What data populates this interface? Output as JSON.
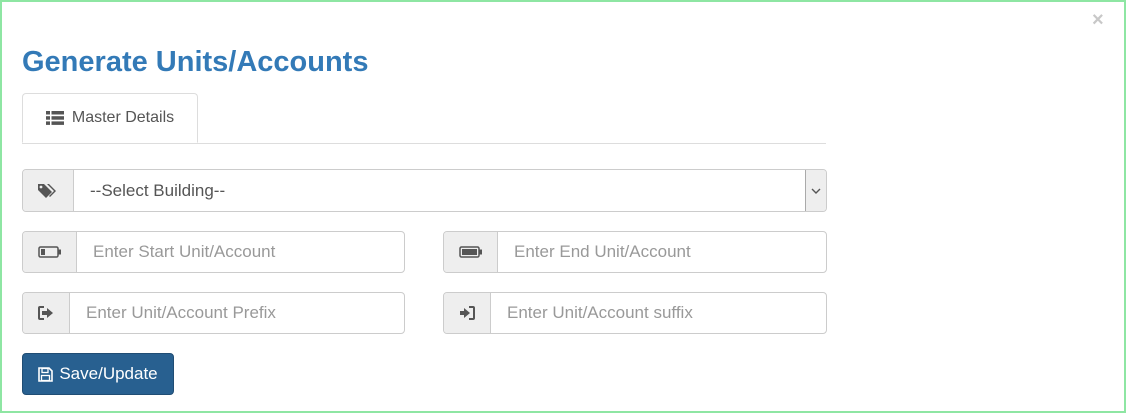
{
  "modal": {
    "title": "Generate Units/Accounts",
    "close_symbol": "×"
  },
  "tabs": [
    {
      "label": "Master Details",
      "icon": "list-icon",
      "active": true
    }
  ],
  "form": {
    "building_select": {
      "selected": "--Select Building--",
      "icon": "tags-icon"
    },
    "start_unit": {
      "placeholder": "Enter Start Unit/Account",
      "value": "",
      "icon": "battery-low-icon"
    },
    "end_unit": {
      "placeholder": "Enter End Unit/Account",
      "value": "",
      "icon": "battery-full-icon"
    },
    "prefix": {
      "placeholder": "Enter Unit/Account Prefix",
      "value": "",
      "icon": "sign-out-icon"
    },
    "suffix": {
      "placeholder": "Enter Unit/Account suffix",
      "value": "",
      "icon": "sign-in-icon"
    }
  },
  "actions": {
    "save_label": "Save/Update",
    "save_icon": "floppy-disk-icon"
  },
  "colors": {
    "title": "#337ab7",
    "button": "#286090",
    "frame_border": "#8ee6a3"
  }
}
